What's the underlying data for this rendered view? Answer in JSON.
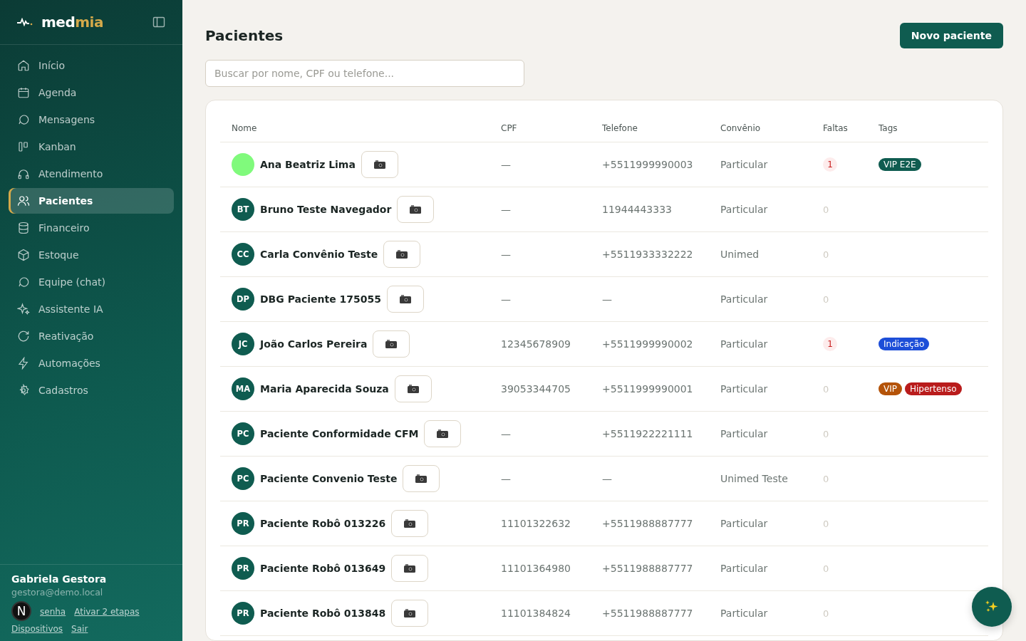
{
  "sidebar": {
    "logo": {
      "part1": "med",
      "part2": "mia"
    },
    "items": [
      {
        "label": "Início",
        "selected": false
      },
      {
        "label": "Agenda",
        "selected": false
      },
      {
        "label": "Mensagens",
        "selected": false
      },
      {
        "label": "Kanban",
        "selected": false
      },
      {
        "label": "Atendimento",
        "selected": false
      },
      {
        "label": "Pacientes",
        "selected": true
      },
      {
        "label": "Financeiro",
        "selected": false
      },
      {
        "label": "Estoque",
        "selected": false
      },
      {
        "label": "Equipe (chat)",
        "selected": false
      },
      {
        "label": "Assistente IA",
        "selected": false
      },
      {
        "label": "Reativação",
        "selected": false
      },
      {
        "label": "Automações",
        "selected": false
      },
      {
        "label": "Cadastros",
        "selected": false
      }
    ],
    "user": {
      "name": "Gabriela Gestora",
      "email": "gestora@demo.local",
      "links": [
        "senha",
        "Ativar 2 etapas",
        "Dispositivos",
        "Sair"
      ]
    },
    "dev_badge": "N"
  },
  "page": {
    "title": "Pacientes",
    "new_button": "Novo paciente",
    "search": {
      "placeholder": "Buscar por nome, CPF ou telefone..."
    }
  },
  "table": {
    "columns": [
      "Nome",
      "CPF",
      "Telefone",
      "Convênio",
      "Faltas",
      "Tags"
    ],
    "rows": [
      {
        "avatar": {
          "kind": "color",
          "color": "#80fa7c"
        },
        "name": "Ana Beatriz Lima",
        "cpf": "—",
        "phone": "+5511999990003",
        "plan": "Particular",
        "absences": "1",
        "absences_alert": true,
        "tags": [
          {
            "label": "VIP E2E",
            "color": "#0f5c50"
          }
        ]
      },
      {
        "avatar": {
          "kind": "initials",
          "text": "BT"
        },
        "name": "Bruno Teste Navegador",
        "cpf": "—",
        "phone": "11944443333",
        "plan": "Particular",
        "absences": "0",
        "absences_alert": false,
        "tags": []
      },
      {
        "avatar": {
          "kind": "initials",
          "text": "CC"
        },
        "name": "Carla Convênio Teste",
        "cpf": "—",
        "phone": "+5511933332222",
        "plan": "Unimed",
        "absences": "0",
        "absences_alert": false,
        "tags": []
      },
      {
        "avatar": {
          "kind": "initials",
          "text": "DP"
        },
        "name": "DBG Paciente 175055",
        "cpf": "—",
        "phone": "—",
        "plan": "Particular",
        "absences": "0",
        "absences_alert": false,
        "tags": []
      },
      {
        "avatar": {
          "kind": "initials",
          "text": "JC"
        },
        "name": "João Carlos Pereira",
        "cpf": "12345678909",
        "phone": "+5511999990002",
        "plan": "Particular",
        "absences": "1",
        "absences_alert": true,
        "tags": [
          {
            "label": "Indicação",
            "color": "#1d4ed8"
          }
        ]
      },
      {
        "avatar": {
          "kind": "initials",
          "text": "MA"
        },
        "name": "Maria Aparecida Souza",
        "cpf": "39053344705",
        "phone": "+5511999990001",
        "plan": "Particular",
        "absences": "0",
        "absences_alert": false,
        "tags": [
          {
            "label": "VIP",
            "color": "#b45309"
          },
          {
            "label": "Hipertenso",
            "color": "#b91c1c"
          }
        ]
      },
      {
        "avatar": {
          "kind": "initials",
          "text": "PC"
        },
        "name": "Paciente Conformidade CFM",
        "cpf": "—",
        "phone": "+5511922221111",
        "plan": "Particular",
        "absences": "0",
        "absences_alert": false,
        "tags": []
      },
      {
        "avatar": {
          "kind": "initials",
          "text": "PC"
        },
        "name": "Paciente Convenio Teste",
        "cpf": "—",
        "phone": "—",
        "plan": "Unimed Teste",
        "absences": "0",
        "absences_alert": false,
        "tags": []
      },
      {
        "avatar": {
          "kind": "initials",
          "text": "PR"
        },
        "name": "Paciente Robô 013226",
        "cpf": "11101322632",
        "phone": "+5511988887777",
        "plan": "Particular",
        "absences": "0",
        "absences_alert": false,
        "tags": []
      },
      {
        "avatar": {
          "kind": "initials",
          "text": "PR"
        },
        "name": "Paciente Robô 013649",
        "cpf": "11101364980",
        "phone": "+5511988887777",
        "plan": "Particular",
        "absences": "0",
        "absences_alert": false,
        "tags": []
      },
      {
        "avatar": {
          "kind": "initials",
          "text": "PR"
        },
        "name": "Paciente Robô 013848",
        "cpf": "11101384824",
        "phone": "+5511988887777",
        "plan": "Particular",
        "absences": "0",
        "absences_alert": false,
        "tags": []
      }
    ]
  }
}
